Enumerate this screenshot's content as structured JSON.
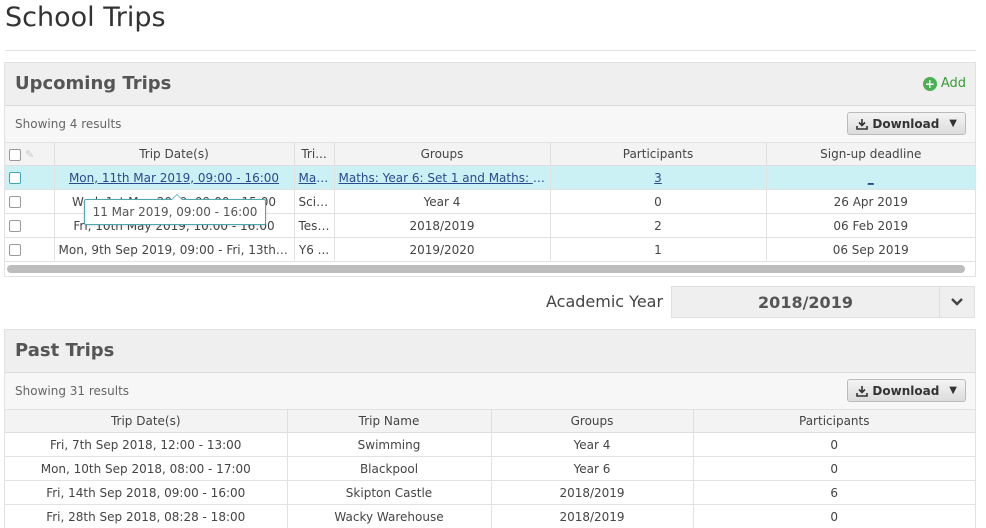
{
  "page": {
    "title": "School Trips"
  },
  "upcoming": {
    "title": "Upcoming Trips",
    "add_label": "Add",
    "showing": "Showing 4 results",
    "download_label": "Download",
    "columns": [
      "Trip Date(s)",
      "Tri...",
      "Groups",
      "Participants",
      "Sign-up deadline"
    ],
    "rows": [
      {
        "date": "Mon, 11th Mar 2019, 09:00 - 16:00",
        "trip": "Mat...",
        "groups": "Maths: Year 6: Set 1 and Maths: Yea...",
        "participants": "3",
        "deadline": "_"
      },
      {
        "date": "Wed, 1st May 2019, 09:00 - 15:00",
        "trip": "Scie...",
        "groups": "Year 4",
        "participants": "0",
        "deadline": "26 Apr 2019"
      },
      {
        "date": "Fri, 10th May 2019, 10:00 - 16:00",
        "trip": "Test...",
        "groups": "2018/2019",
        "participants": "2",
        "deadline": "06 Feb 2019"
      },
      {
        "date": "Mon, 9th Sep 2019, 09:00 - Fri, 13th Se...",
        "trip": "Y6 ...",
        "groups": "2019/2020",
        "participants": "1",
        "deadline": "06 Sep 2019"
      }
    ],
    "tooltip": "11 Mar 2019, 09:00 - 16:00"
  },
  "academic_year": {
    "label": "Academic Year",
    "value": "2018/2019"
  },
  "past": {
    "title": "Past Trips",
    "showing": "Showing 31 results",
    "download_label": "Download",
    "columns": [
      "Trip Date(s)",
      "Trip Name",
      "Groups",
      "Participants"
    ],
    "rows": [
      {
        "date": "Fri, 7th Sep 2018, 12:00 - 13:00",
        "name": "Swimming",
        "groups": "Year 4",
        "participants": "0"
      },
      {
        "date": "Mon, 10th Sep 2018, 08:00 - 17:00",
        "name": "Blackpool",
        "groups": "Year 6",
        "participants": "0"
      },
      {
        "date": "Fri, 14th Sep 2018, 09:00 - 16:00",
        "name": "Skipton Castle",
        "groups": "2018/2019",
        "participants": "6"
      },
      {
        "date": "Fri, 28th Sep 2018, 08:28 - 18:00",
        "name": "Wacky Warehouse",
        "groups": "2018/2019",
        "participants": "0"
      }
    ]
  },
  "colors": {
    "highlight_row": "#ccf1f5",
    "link": "#2b4a8c",
    "add_green": "#4caf50",
    "tooltip_border": "#4aa8b0"
  },
  "icons": {
    "add": "plus-circle-icon",
    "download": "download-icon",
    "caret": "caret-down-icon",
    "chevron": "chevron-down-icon",
    "edit": "pencil-icon"
  }
}
